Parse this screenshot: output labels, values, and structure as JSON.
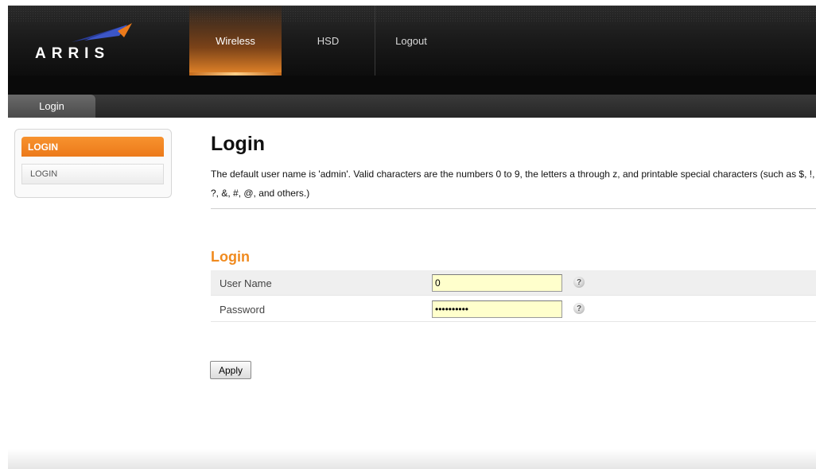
{
  "brand": {
    "name": "ARRIS",
    "accent_color": "#ec7a1a"
  },
  "nav": {
    "items": [
      {
        "label": "Wireless",
        "active": true
      },
      {
        "label": "HSD",
        "active": false
      },
      {
        "label": "Logout",
        "active": false
      }
    ]
  },
  "tab": {
    "label": "Login"
  },
  "sidebar": {
    "header": "LOGIN",
    "items": [
      {
        "label": "LOGIN"
      }
    ]
  },
  "page": {
    "title": "Login",
    "description": "The default user name is 'admin'. Valid characters are the numbers 0 to 9, the letters a through z, and printable special characters (such as $, !, ?, &, #, @, and others.)"
  },
  "form": {
    "section_title": "Login",
    "fields": [
      {
        "label": "User Name",
        "value": "0",
        "type": "text",
        "help_icon": "question-icon"
      },
      {
        "label": "Password",
        "value": "••••••••••",
        "type": "password",
        "help_icon": "question-icon"
      }
    ],
    "apply_label": "Apply"
  }
}
